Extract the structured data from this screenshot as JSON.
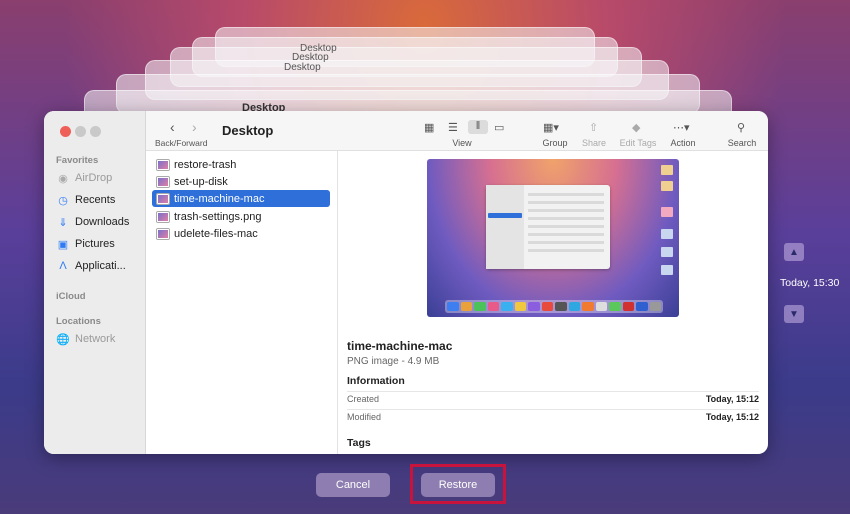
{
  "window": {
    "title": "Desktop",
    "nav_label": "Back/Forward"
  },
  "background_windows": {
    "titles": [
      "Desktop",
      "Desktop",
      "Desktop",
      "Desktop"
    ]
  },
  "sidebar": {
    "favorites_header": "Favorites",
    "favorites": [
      {
        "label": "AirDrop",
        "icon": "airdrop-icon",
        "dim": true
      },
      {
        "label": "Recents",
        "icon": "clock-icon",
        "dim": false
      },
      {
        "label": "Downloads",
        "icon": "download-icon",
        "dim": false
      },
      {
        "label": "Pictures",
        "icon": "pictures-icon",
        "dim": false
      },
      {
        "label": "Applicati...",
        "icon": "applications-icon",
        "dim": false
      }
    ],
    "icloud_header": "iCloud",
    "locations_header": "Locations",
    "locations": [
      {
        "label": "Network",
        "icon": "network-icon",
        "dim": true
      }
    ]
  },
  "toolbar": {
    "view_label": "View",
    "group_label": "Group",
    "share_label": "Share",
    "edit_tags_label": "Edit Tags",
    "action_label": "Action",
    "search_label": "Search"
  },
  "files": [
    {
      "name": "restore-trash",
      "selected": false
    },
    {
      "name": "set-up-disk",
      "selected": false
    },
    {
      "name": "time-machine-mac",
      "selected": true
    },
    {
      "name": "trash-settings.png",
      "selected": false
    },
    {
      "name": "udelete-files-mac",
      "selected": false
    }
  ],
  "preview": {
    "name": "time-machine-mac",
    "kind": "PNG image - 4.9 MB",
    "information_header": "Information",
    "created_label": "Created",
    "created_value": "Today, 15:12",
    "modified_label": "Modified",
    "modified_value": "Today, 15:12",
    "tags_header": "Tags"
  },
  "time_machine": {
    "timestamp": "Today, 15:30"
  },
  "dialog": {
    "cancel_label": "Cancel",
    "restore_label": "Restore"
  },
  "colors": {
    "accent": "#2e6fd9",
    "highlight": "#c8143c"
  }
}
